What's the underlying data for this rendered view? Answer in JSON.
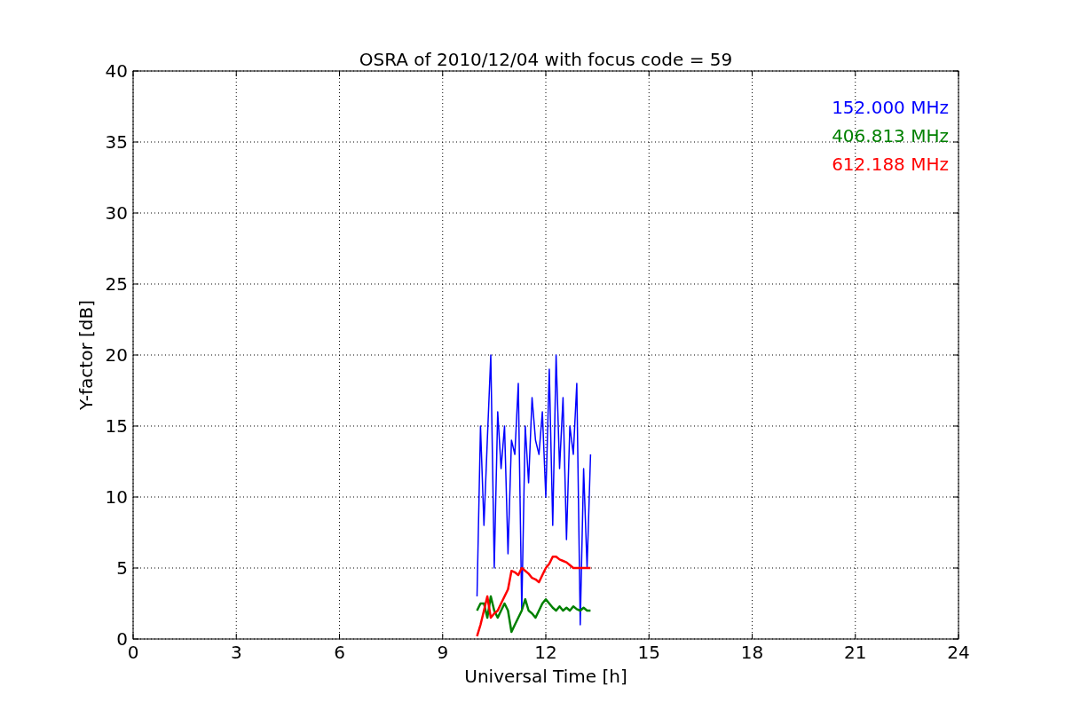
{
  "figure": {
    "chart_data": {
      "type": "line",
      "title": "OSRA of 2010/12/04 with focus code = 59",
      "xlabel": "Universal Time [h]",
      "ylabel": "Y-factor [dB]",
      "x": [
        10.0,
        10.1,
        10.2,
        10.3,
        10.4,
        10.5,
        10.6,
        10.7,
        10.8,
        10.9,
        11.0,
        11.1,
        11.2,
        11.3,
        11.4,
        11.5,
        11.6,
        11.7,
        11.8,
        11.9,
        12.0,
        12.1,
        12.2,
        12.3,
        12.4,
        12.5,
        12.6,
        12.7,
        12.8,
        12.9,
        13.0,
        13.1,
        13.2,
        13.3
      ],
      "series": [
        {
          "name": "152.000 MHz",
          "color": "#0000ff",
          "values": [
            3,
            15,
            8,
            14,
            20,
            5,
            16,
            12,
            15,
            6,
            14,
            13,
            18,
            2,
            15,
            11,
            17,
            14,
            13,
            16,
            10,
            19,
            8,
            20,
            12,
            17,
            7,
            15,
            13,
            18,
            1,
            12,
            5,
            13
          ]
        },
        {
          "name": "406.813 MHz",
          "color": "#008000",
          "values": [
            2,
            2.5,
            2.5,
            1.5,
            3,
            2,
            1.5,
            2,
            2.5,
            2,
            0.5,
            1,
            1.5,
            2,
            2.8,
            2,
            1.8,
            1.5,
            2,
            2.5,
            2.8,
            2.5,
            2.2,
            2,
            2.3,
            2,
            2.2,
            2,
            2.3,
            2.1,
            2,
            2.2,
            2,
            2
          ]
        },
        {
          "name": "612.188 MHz",
          "color": "#ff0000",
          "values": [
            0.2,
            1,
            2,
            3,
            1.5,
            1.8,
            2,
            2.5,
            3,
            3.5,
            4.8,
            4.7,
            4.5,
            5,
            4.8,
            4.6,
            4.3,
            4.2,
            4,
            4.5,
            5,
            5.3,
            5.8,
            5.8,
            5.6,
            5.5,
            5.4,
            5.2,
            5,
            5,
            5,
            5,
            5,
            5
          ]
        }
      ],
      "xlim": [
        0,
        24
      ],
      "ylim": [
        0,
        40
      ],
      "xticks": [
        0,
        3,
        6,
        9,
        12,
        15,
        18,
        21,
        24
      ],
      "yticks": [
        0,
        5,
        10,
        15,
        20,
        25,
        30,
        35,
        40
      ],
      "grid": true
    }
  }
}
